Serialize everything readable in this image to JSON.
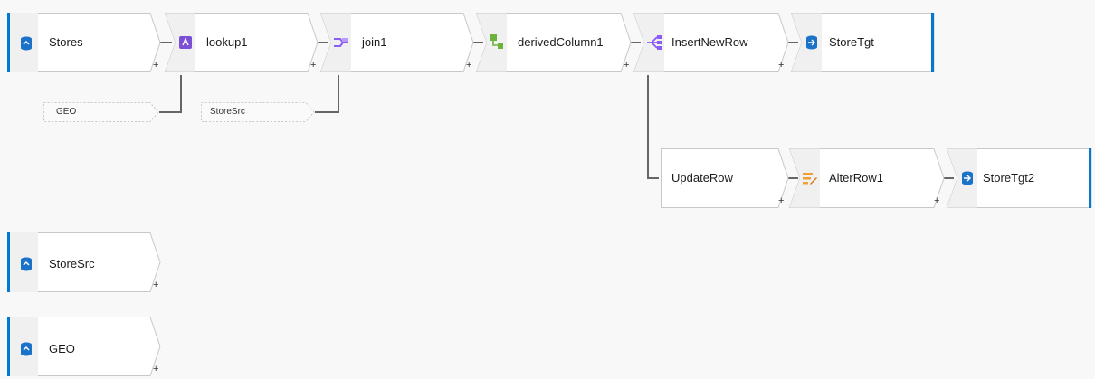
{
  "nodes": {
    "stores": "Stores",
    "lookup1": "lookup1",
    "join1": "join1",
    "derivedColumn1": "derivedColumn1",
    "insertNewRow": "InsertNewRow",
    "storeTgt": "StoreTgt",
    "updateRow": "UpdateRow",
    "alterRow1": "AlterRow1",
    "storeTgt2": "StoreTgt2",
    "storeSrc": "StoreSrc",
    "geo": "GEO"
  },
  "refs": {
    "geo": "GEO",
    "storeSrc": "StoreSrc"
  },
  "add_symbol": "+",
  "colors": {
    "source_accent": "#0078d4",
    "sink_accent": "#0078d4",
    "node_border": "#c8c8c8",
    "node_fill": "#ffffff",
    "icon_strip": "#f0f0f0",
    "wire": "#666666",
    "lookup_icon": "#7b4fd6",
    "join_icon": "#8a5cf6",
    "derived_icon": "#6cb33e",
    "split_icon": "#8a5cf6",
    "alter_icon": "#f0a030",
    "db_icon": "#1a73c8"
  },
  "icons": {
    "stores": "database-icon",
    "lookup1": "lookup-icon",
    "join1": "join-icon",
    "derivedColumn1": "derived-column-icon",
    "insertNewRow": "conditional-split-icon",
    "storeTgt": "database-sink-icon",
    "alterRow1": "alter-row-icon",
    "storeTgt2": "database-sink-icon",
    "storeSrc": "database-icon",
    "geo": "database-icon"
  }
}
